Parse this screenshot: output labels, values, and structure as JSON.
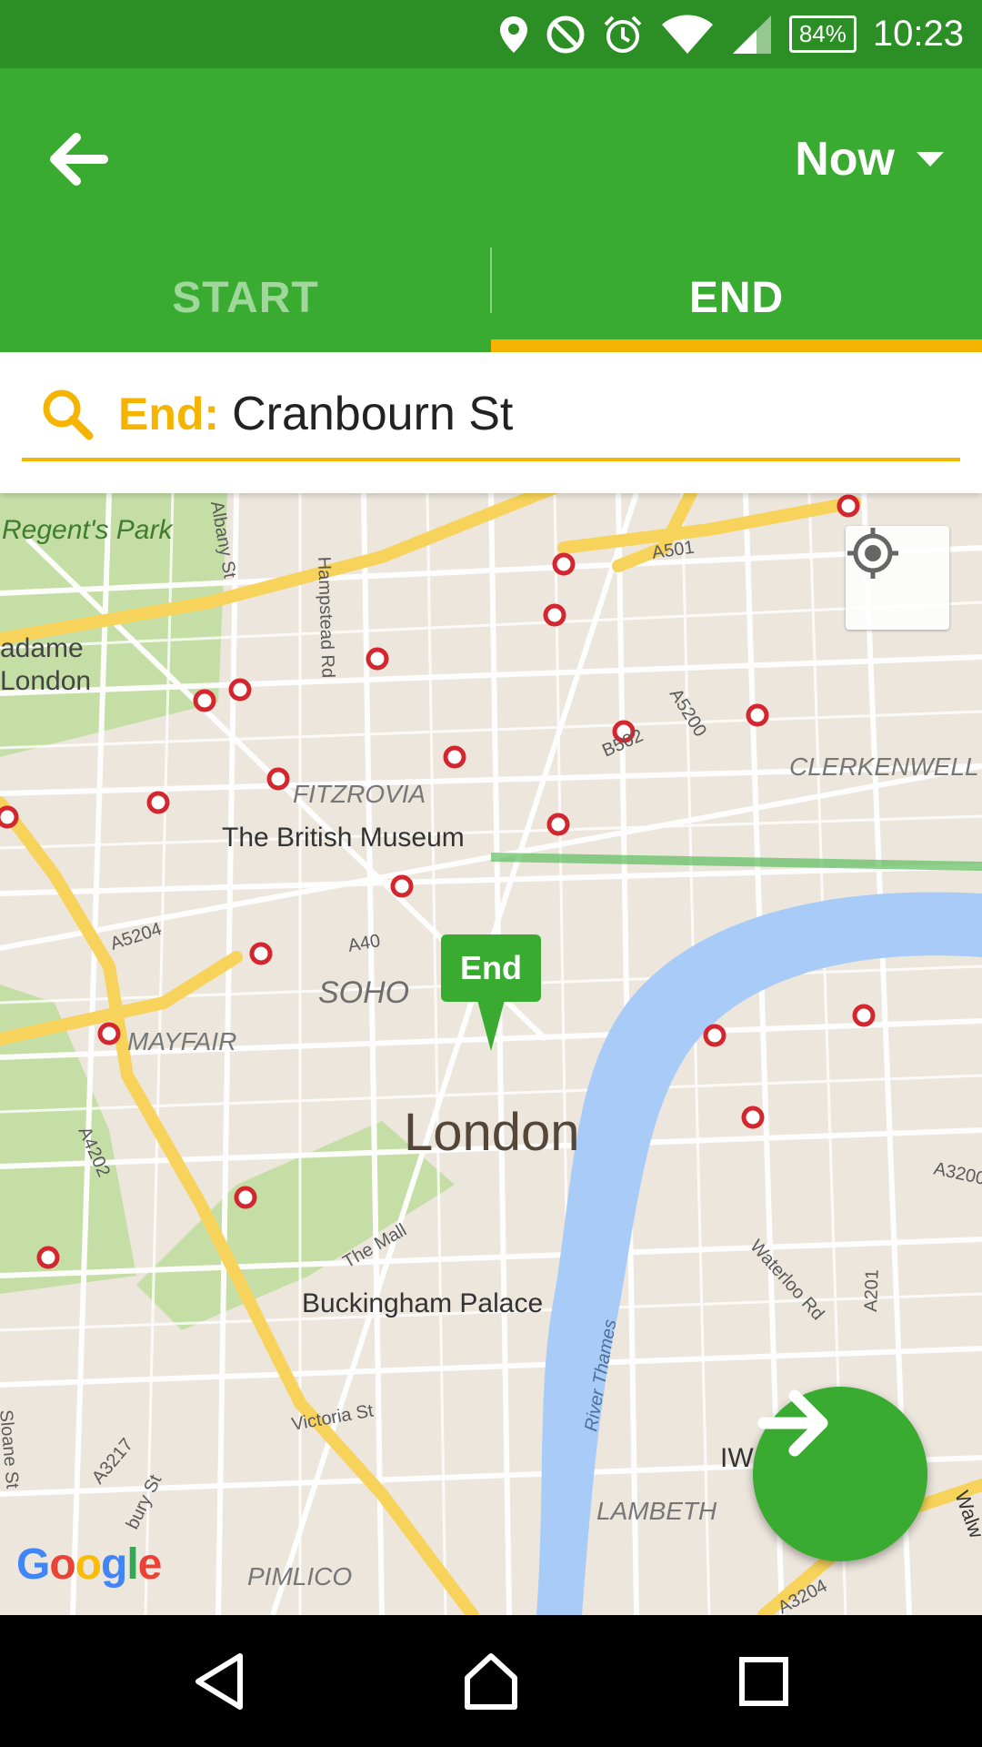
{
  "status_bar": {
    "battery": "84%",
    "time": "10:23",
    "icons": [
      "location-icon",
      "do-not-disturb-icon",
      "alarm-icon",
      "wifi-icon",
      "signal-icon",
      "battery-icon"
    ]
  },
  "app_bar": {
    "time_option": "Now",
    "tabs": [
      {
        "label": "START",
        "selected": false
      },
      {
        "label": "END",
        "selected": true
      }
    ],
    "colors": {
      "primary": "#39ab31",
      "accent": "#f4b400"
    }
  },
  "search": {
    "prefix": "End:",
    "value": "Cranbourn St"
  },
  "map": {
    "marker_label": "End",
    "labels": {
      "regents_park": "Regent's Park",
      "madame": "adame",
      "london_small": "London",
      "albany": "Albany St",
      "hampstead": "Hampstead Rd",
      "a501": "A501",
      "a5200": "A5200",
      "b502": "B502",
      "clerkenwell": "CLERKENWELL",
      "fitzrovia": "FITZROVIA",
      "british_museum": "The British Museum",
      "a5204": "A5204",
      "a40": "A40",
      "soho": "SOHO",
      "mayfair": "MAYFAIR",
      "a4202": "A4202",
      "london": "London",
      "a3200": "A3200",
      "the_mall": "The Mall",
      "waterloo": "Waterloo Rd",
      "a201": "A201",
      "buckingham": "Buckingham Palace",
      "river_thames": "River Thames",
      "victoria": "Victoria St",
      "a3217": "A3217",
      "sloane": "Sloane St",
      "bury": "bury St",
      "iw": "IW",
      "lambeth": "LAMBETH",
      "pimlico": "PIMLICO",
      "a3204": "A3204",
      "walw": "Walw"
    },
    "attribution": "Google"
  },
  "nav_bar": {
    "buttons": [
      "back-icon",
      "home-icon",
      "recents-icon"
    ]
  }
}
